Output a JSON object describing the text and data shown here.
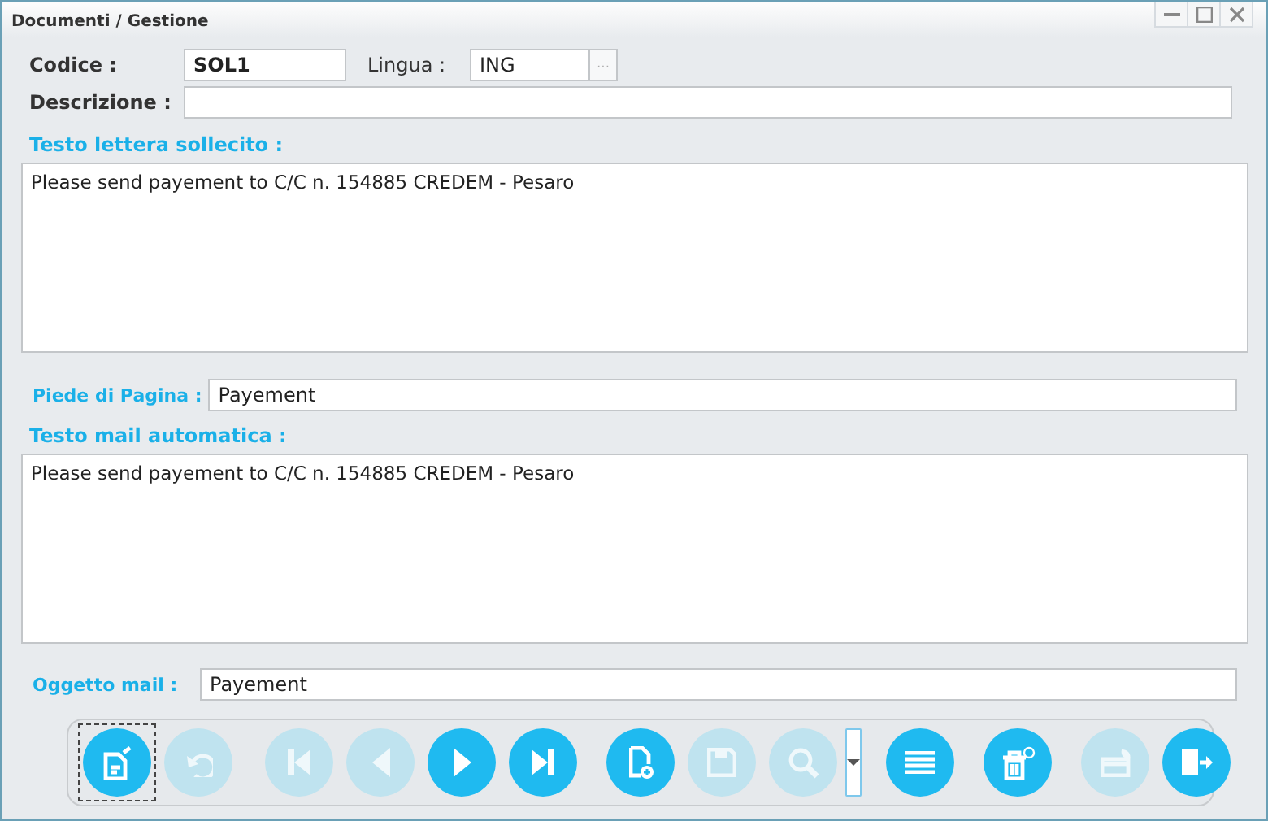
{
  "window": {
    "title": "Documenti / Gestione"
  },
  "header": {
    "code_label": "Codice :",
    "code_value": "SOL1",
    "language_label": "Lingua :",
    "language_value": "ING",
    "lookup_button": "···",
    "description_label": "Descrizione :"
  },
  "letter": {
    "label": "Testo lettera sollecito :",
    "value": "Please send payement to C/C n. 154885 CREDEM - Pesaro"
  },
  "footer_field": {
    "label": "Piede di Pagina :",
    "value": "Payement"
  },
  "mail": {
    "label": "Testo mail automatica :",
    "value": "Please send payement to C/C n. 154885 CREDEM - Pesaro"
  },
  "subject_field": {
    "label": "Oggetto mail :",
    "value": "Payement"
  },
  "toolbar": [
    {
      "kind": "edit",
      "disabled": false,
      "focused": true
    },
    {
      "kind": "undo",
      "disabled": true,
      "focused": false
    },
    {
      "kind": "first",
      "disabled": true,
      "focused": false
    },
    {
      "kind": "prev",
      "disabled": true,
      "focused": false
    },
    {
      "kind": "next",
      "disabled": false,
      "focused": false
    },
    {
      "kind": "last",
      "disabled": false,
      "focused": false
    },
    {
      "kind": "new",
      "disabled": false,
      "focused": false
    },
    {
      "kind": "save",
      "disabled": true,
      "focused": false
    },
    {
      "kind": "search",
      "disabled": true,
      "focused": false
    },
    {
      "kind": "dropdown",
      "disabled": false,
      "focused": false
    },
    {
      "kind": "list",
      "disabled": false,
      "focused": false
    },
    {
      "kind": "delete",
      "disabled": false,
      "focused": false
    },
    {
      "kind": "print",
      "disabled": true,
      "focused": false
    },
    {
      "kind": "exit",
      "disabled": false,
      "focused": false
    }
  ]
}
